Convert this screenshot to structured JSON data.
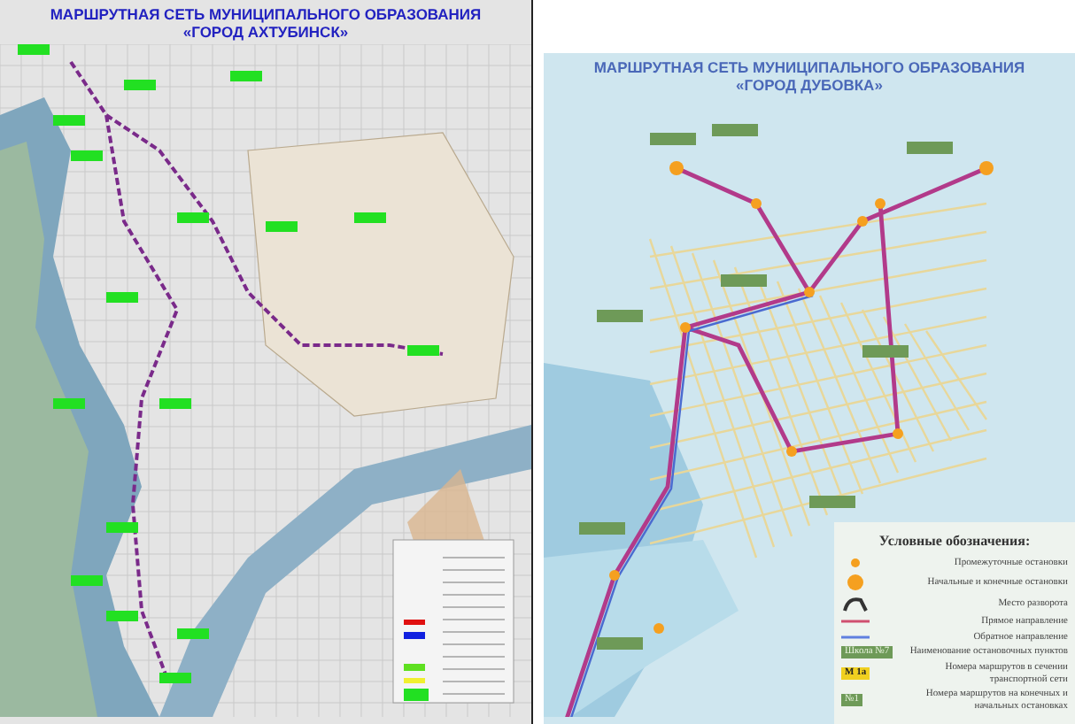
{
  "maps": [
    {
      "kind": "grey-plan",
      "title_lines": [
        "МАРШРУТНАЯ СЕТЬ МУНИЦИПАЛЬНОГО ОБРАЗОВАНИЯ",
        "«ГОРОД АХТУБИНСК»"
      ]
    },
    {
      "kind": "blue-scheme",
      "title_lines": [
        "МАРШРУТНАЯ СЕТЬ МУНИЦИПАЛЬНОГО ОБРАЗОВАНИЯ",
        "«ГОРОД ДУБОВКА»"
      ],
      "legend": {
        "title": "Условные обозначения:",
        "items": [
          {
            "kind": "small-dot",
            "label": "Промежуточные остановки"
          },
          {
            "kind": "big-dot",
            "label": "Начальные и конечные остановки"
          },
          {
            "kind": "turn",
            "label": "Место разворота"
          },
          {
            "kind": "red-line",
            "label": "Прямое направление"
          },
          {
            "kind": "blue-line",
            "label": "Обратное направление"
          },
          {
            "kind": "green-tag",
            "swatch_text": "Школа №7",
            "label": "Наименование остановочных пунктов"
          },
          {
            "kind": "yellow-tag",
            "swatch_text": "М 1а",
            "label": "Номера маршрутов в сечении транспортной сети"
          },
          {
            "kind": "green-tag",
            "swatch_text": "№1",
            "label": "Номера маршрутов на конечных и начальных остановках"
          }
        ]
      }
    }
  ]
}
